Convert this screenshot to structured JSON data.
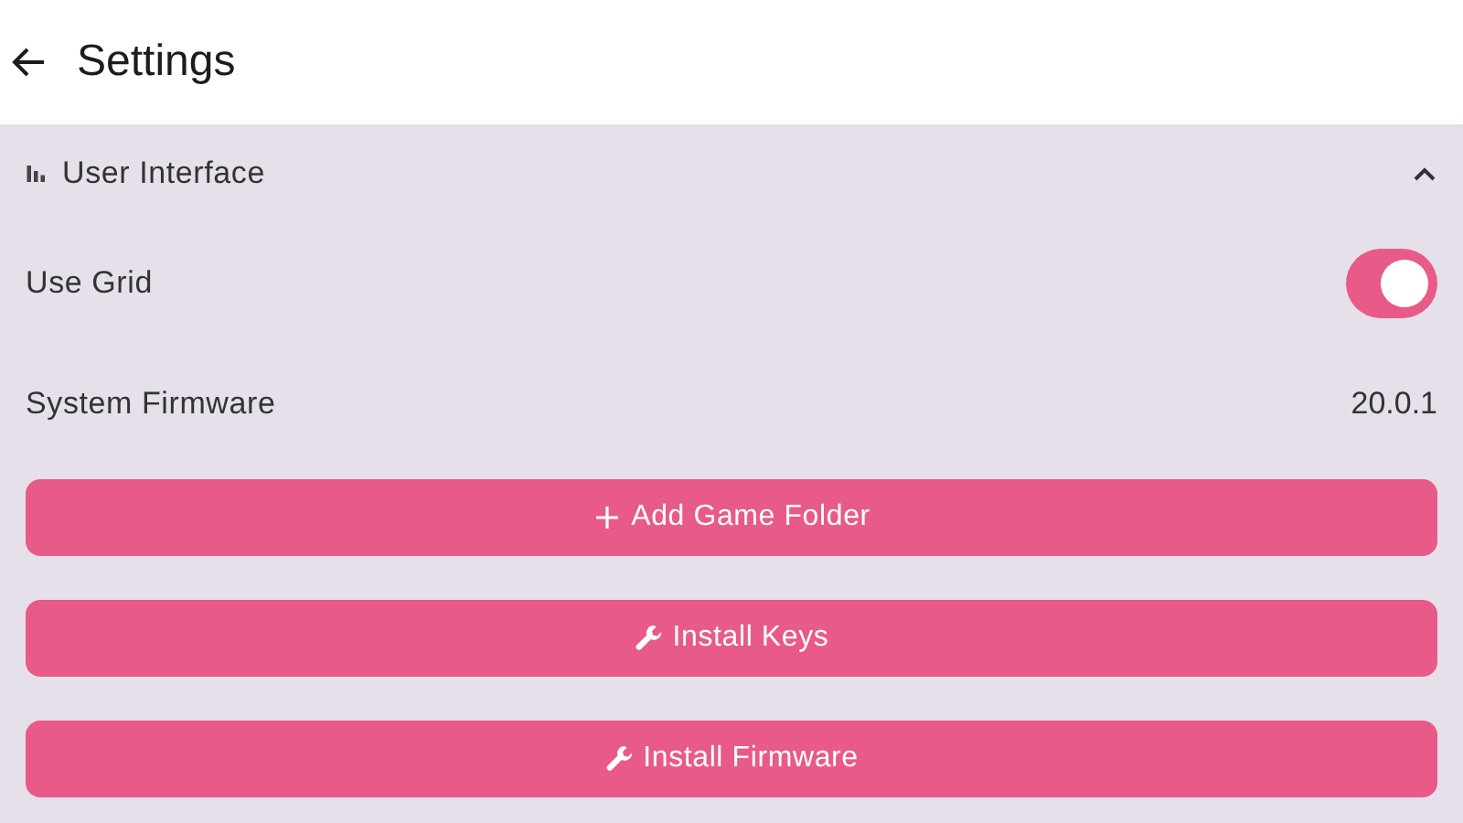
{
  "header": {
    "title": "Settings"
  },
  "section": {
    "title": "User Interface",
    "expanded": true,
    "rows": [
      {
        "kind": "toggle",
        "label": "Use Grid",
        "on": true
      },
      {
        "kind": "value",
        "label": "System Firmware",
        "value": "20.0.1"
      }
    ],
    "buttons": [
      {
        "kind": "add",
        "label": "Add Game Folder"
      },
      {
        "kind": "wrench",
        "label": "Install Keys"
      },
      {
        "kind": "wrench",
        "label": "Install Firmware"
      }
    ]
  }
}
